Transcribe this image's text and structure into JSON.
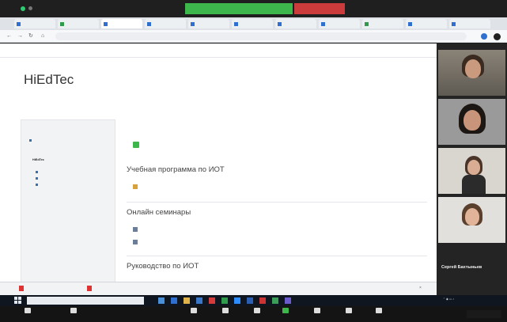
{
  "zoom": {
    "share_banner": "",
    "stop_share": "",
    "end_button": ""
  },
  "browser": {
    "tabs": [
      "",
      "",
      "",
      "",
      "",
      "",
      "",
      "",
      "",
      "",
      ""
    ],
    "url": ""
  },
  "moodle": {
    "brand": "",
    "brand_sub": "",
    "site_title": "HiEdTec",
    "breadcrumb": "",
    "nav_heading": "",
    "nav_items": [
      "",
      "",
      "",
      "",
      "HiEdTec",
      "",
      "",
      "",
      "",
      "",
      "",
      "",
      "",
      "",
      "",
      "",
      "",
      ""
    ],
    "news_label": "",
    "sections": [
      {
        "title": "Учебная программа по ИОТ",
        "activities": [
          ""
        ]
      },
      {
        "title": "Онлайн семинары",
        "activities": [
          "",
          ""
        ]
      },
      {
        "title": "Руководство по ИОТ",
        "activities": []
      }
    ],
    "footer_note": ""
  },
  "downloads": {
    "items": [
      "",
      ""
    ],
    "show_all": ""
  },
  "taskbar": {
    "search_placeholder": "",
    "clock_time": "",
    "clock_date": ""
  },
  "participants": [
    {
      "name": ""
    },
    {
      "name": ""
    },
    {
      "name": ""
    },
    {
      "name": ""
    }
  ],
  "active_speaker": "Сергей Бахтыньев",
  "zoom_controls": [
    "",
    "",
    "",
    "",
    "",
    "",
    "",
    "",
    ""
  ],
  "colors": {
    "share_green": "#3db74b",
    "stop_red": "#cc3b3b",
    "link_blue": "#3a6fb0"
  }
}
